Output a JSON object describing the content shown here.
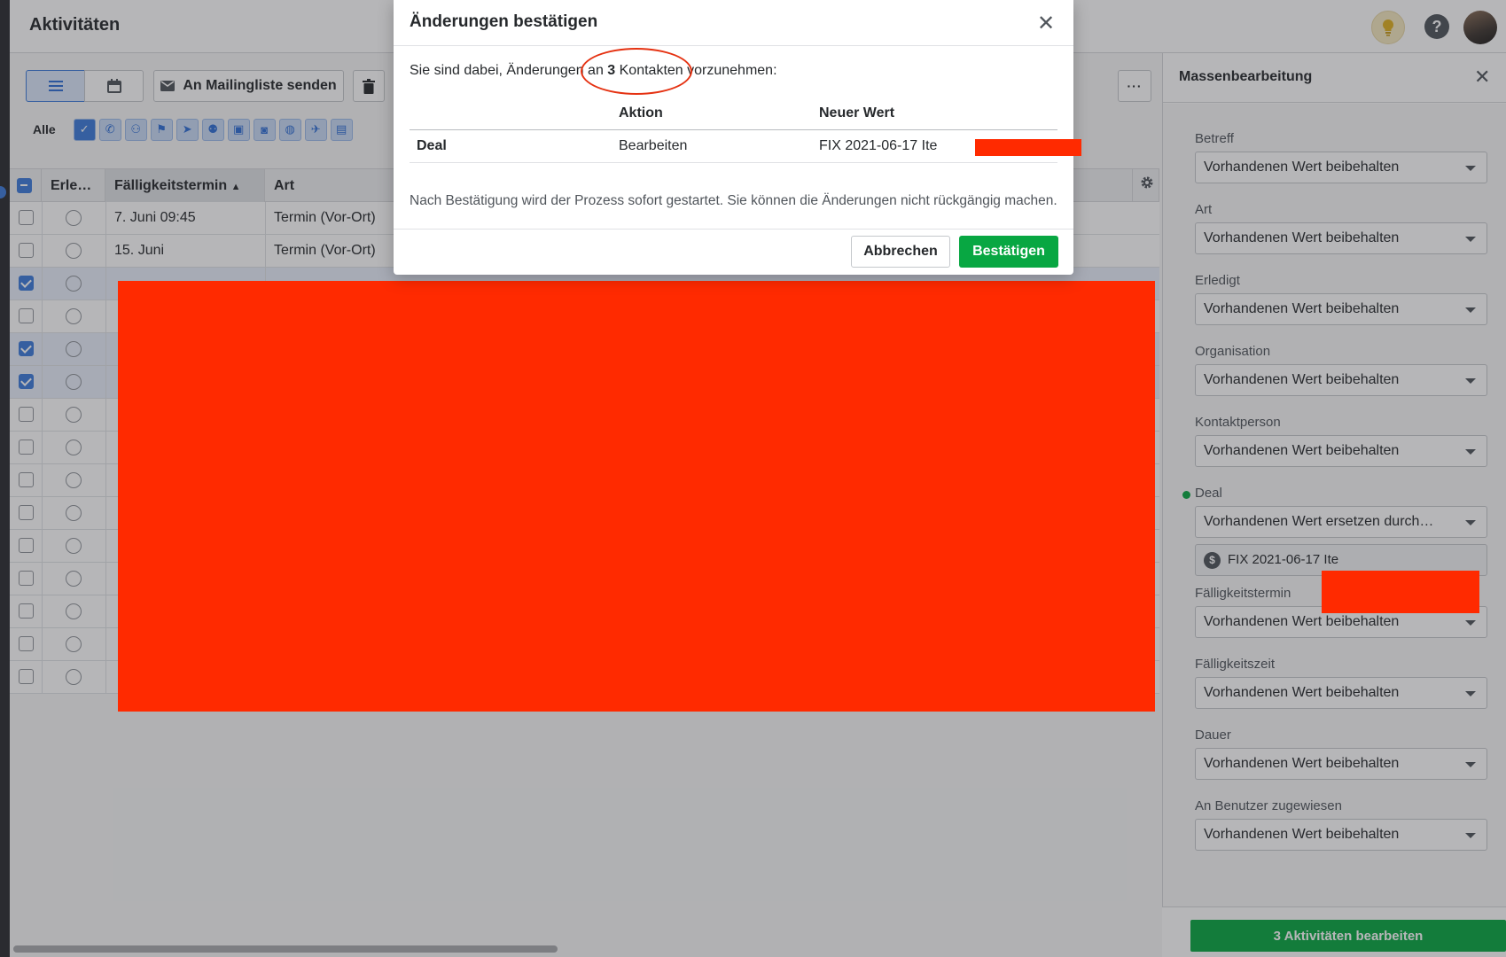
{
  "header": {
    "title": "Aktivitäten",
    "help_glyph": "?"
  },
  "toolbar": {
    "mail_label": "An Mailingliste senden",
    "more_label": "···",
    "filter_all": "Alle",
    "filters": [
      "checkbox-icon",
      "phone-icon",
      "meeting-icon",
      "flag-icon",
      "send-icon",
      "group-icon",
      "briefcase-icon",
      "camera-icon",
      "globe-icon",
      "plane-icon",
      "lock-icon"
    ]
  },
  "table": {
    "columns": [
      "Erle…",
      "Fälligkeitstermin",
      "Art"
    ],
    "rows": [
      {
        "date": "7. Juni 09:45",
        "type": "Termin (Vor-Ort)",
        "selected": false
      },
      {
        "date": "15. Juni",
        "type": "Termin (Vor-Ort)",
        "selected": false
      },
      {
        "date": "",
        "type": "",
        "selected": true
      },
      {
        "date": "",
        "type": "",
        "selected": false
      },
      {
        "date": "",
        "type": "",
        "selected": true
      },
      {
        "date": "",
        "type": "",
        "selected": true
      },
      {
        "date": "",
        "type": "",
        "selected": false
      },
      {
        "date": "",
        "type": "",
        "selected": false
      },
      {
        "date": "",
        "type": "",
        "selected": false
      },
      {
        "date": "",
        "type": "",
        "selected": false
      },
      {
        "date": "",
        "type": "",
        "selected": false
      },
      {
        "date": "",
        "type": "",
        "selected": false
      },
      {
        "date": "",
        "type": "",
        "selected": false
      },
      {
        "date": "",
        "type": "",
        "selected": false
      },
      {
        "date": "",
        "type": "",
        "selected": false
      }
    ]
  },
  "panel": {
    "title": "Massenbearbeitung",
    "fields": [
      {
        "label": "Betreff",
        "value": "Vorhandenen Wert beibehalten"
      },
      {
        "label": "Art",
        "value": "Vorhandenen Wert beibehalten"
      },
      {
        "label": "Erledigt",
        "value": "Vorhandenen Wert beibehalten"
      },
      {
        "label": "Organisation",
        "value": "Vorhandenen Wert beibehalten"
      },
      {
        "label": "Kontaktperson",
        "value": "Vorhandenen Wert beibehalten"
      },
      {
        "label": "Deal",
        "value": "Vorhandenen Wert ersetzen durch…"
      },
      {
        "label": "Fälligkeitstermin",
        "value": "Vorhandenen Wert beibehalten"
      },
      {
        "label": "Fälligkeitszeit",
        "value": "Vorhandenen Wert beibehalten"
      },
      {
        "label": "Dauer",
        "value": "Vorhandenen Wert beibehalten"
      },
      {
        "label": "An Benutzer zugewiesen",
        "value": "Vorhandenen Wert beibehalten"
      }
    ],
    "deal_chip": "FIX 2021-06-17 Ite",
    "apply_label": "3 Aktivitäten bearbeiten"
  },
  "modal": {
    "title": "Änderungen bestätigen",
    "intro_before": "Sie sind dabei, Änderungen an ",
    "intro_count": "3",
    "intro_after": " Kontakten vorzunehmen:",
    "col_action": "Aktion",
    "col_new_value": "Neuer Wert",
    "row_field": "Deal",
    "row_action": "Bearbeiten",
    "row_value": "FIX 2021-06-17 Ite",
    "note": "Nach Bestätigung wird der Prozess sofort gestartet. Sie können die Änderungen nicht rückgängig machen.",
    "cancel_label": "Abbrechen",
    "confirm_label": "Bestätigen"
  },
  "colors": {
    "accent": "#3d7cdb",
    "confirm": "#08a742",
    "redaction": "#ff2a00",
    "annotation": "#e53212"
  }
}
